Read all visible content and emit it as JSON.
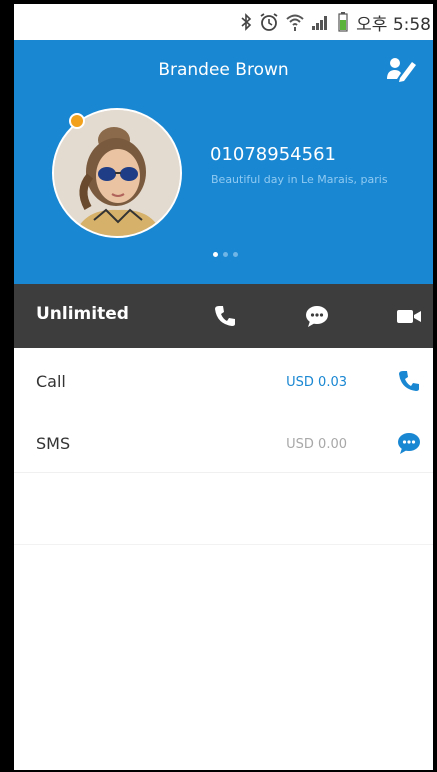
{
  "status_bar": {
    "time": "오후 5:58",
    "icons": [
      "bluetooth-icon",
      "alarm-icon",
      "wifi-icon",
      "signal-icon",
      "battery-icon"
    ]
  },
  "contact": {
    "name": "Brandee Brown",
    "phone": "01078954561",
    "status_message": "Beautiful day in Le Marais, paris",
    "presence_color": "#f2a11c",
    "page_indicator": {
      "pages": 3,
      "active": 1
    }
  },
  "action_bar": {
    "plan_label": "Unlimited",
    "actions": [
      "phone-icon",
      "chat-icon",
      "video-icon"
    ]
  },
  "rates": [
    {
      "label": "Call",
      "price": "USD 0.03",
      "price_color": "#1a87d2",
      "icon": "phone-icon"
    },
    {
      "label": "SMS",
      "price": "USD 0.00",
      "price_color": "#a8a8a8",
      "icon": "chat-icon"
    }
  ],
  "colors": {
    "header_bg": "#1a87d2",
    "action_bar_bg": "#3d3d3d",
    "accent": "#1a87d2"
  }
}
